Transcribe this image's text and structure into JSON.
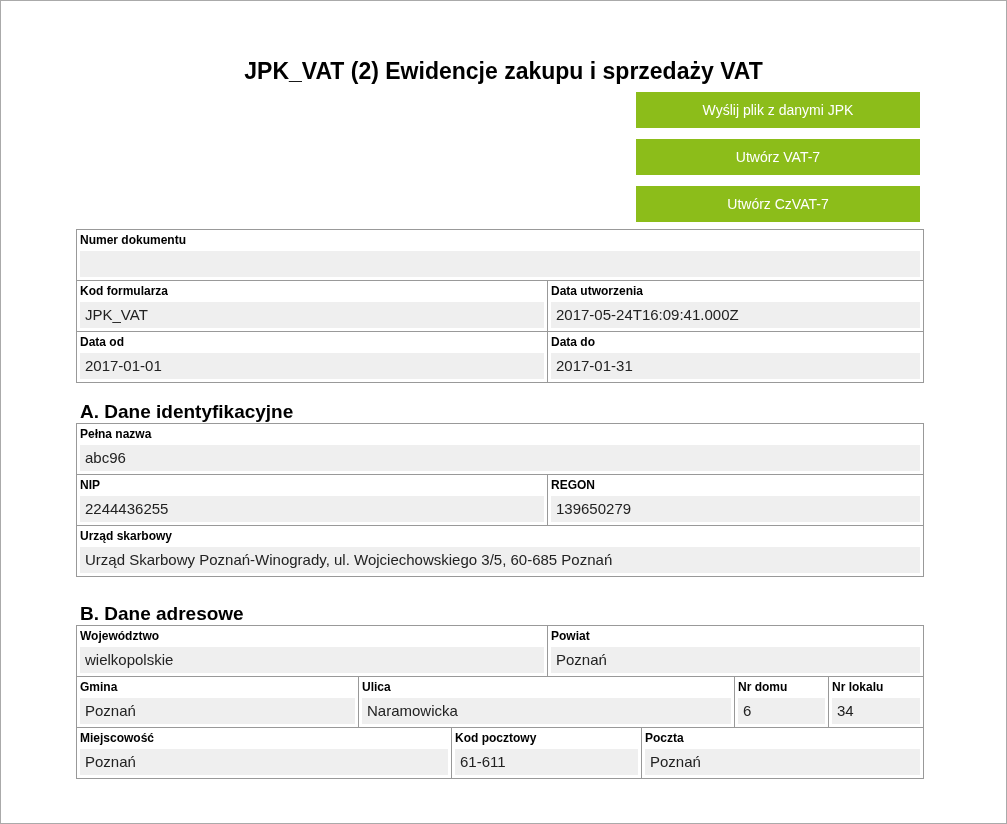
{
  "title": "JPK_VAT (2) Ewidencje zakupu i sprzedaży VAT",
  "buttons": [
    "Wyślij plik z danymi JPK",
    "Utwórz VAT-7",
    "Utwórz CzVAT-7"
  ],
  "sections": [
    {
      "rows": [
        {
          "cells": [
            {
              "label": "Numer dokumentu"
            }
          ]
        },
        {
          "cells": [
            {
              "label": "Kod formularza",
              "value": "JPK_VAT"
            },
            {
              "label": "Data utworzenia",
              "value": "2017-05-24T16:09:41.000Z"
            }
          ]
        },
        {
          "cells": [
            {
              "label": "Data od",
              "value": "2017-01-01"
            },
            {
              "label": "Data do",
              "value": "2017-01-31"
            }
          ]
        }
      ]
    },
    {
      "heading": "A. Dane identyfikacyjne",
      "rows": [
        {
          "cells": [
            {
              "label": "Pełna nazwa",
              "value": "abc96"
            }
          ]
        },
        {
          "cells": [
            {
              "label": "NIP",
              "value": "2244436255"
            },
            {
              "label": "REGON",
              "value": "139650279"
            }
          ]
        },
        {
          "cells": [
            {
              "label": "Urząd skarbowy",
              "value": "Urząd Skarbowy Poznań-Winogrady, ul. Wojciechowskiego 3/5, 60-685 Poznań"
            }
          ]
        }
      ]
    },
    {
      "heading": "B. Dane adresowe",
      "rows": [
        {
          "cells": [
            {
              "label": "Województwo",
              "value": "wielkopolskie"
            },
            {
              "label": "Powiat",
              "value": "Poznań"
            }
          ]
        },
        {
          "cells": [
            {
              "label": "Gmina",
              "value": "Poznań"
            },
            {
              "label": "Ulica",
              "value": "Naramowicka"
            },
            {
              "label": "Nr domu",
              "value": "6"
            },
            {
              "label": "Nr lokalu",
              "value": "34"
            }
          ]
        },
        {
          "cells": [
            {
              "label": "Miejscowość",
              "value": "Poznań"
            },
            {
              "label": "Kod pocztowy",
              "value": "61-611"
            },
            {
              "label": "Poczta",
              "value": "Poznań"
            }
          ]
        }
      ]
    }
  ]
}
